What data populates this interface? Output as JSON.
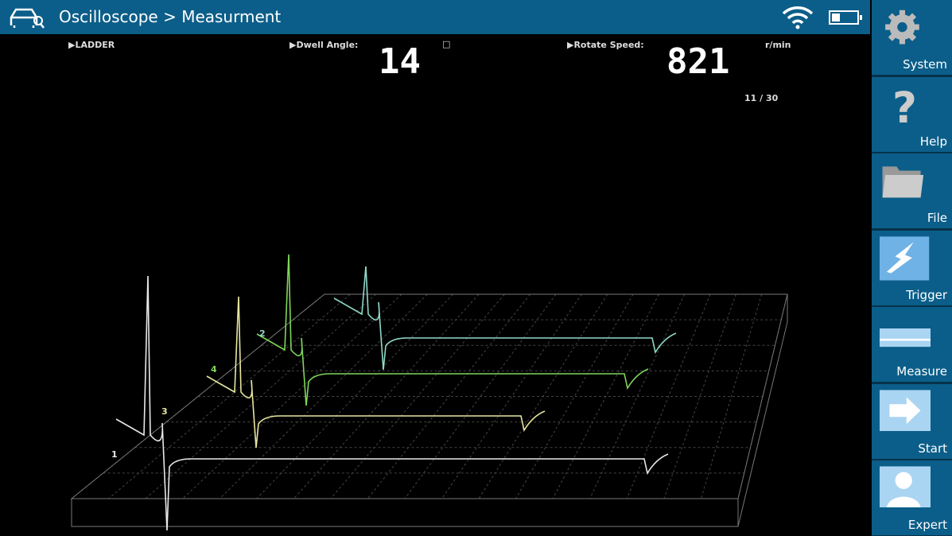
{
  "header": {
    "title": "Oscilloscope > Measurment",
    "car_icon": "car-diagnostic-icon",
    "wifi_icon": "wifi-icon",
    "battery_icon": "battery-icon"
  },
  "readouts": {
    "mode": "▶LADDER",
    "dwell_label": "▶Dwell Angle:",
    "dwell_value": "14",
    "dwell_unit": "□",
    "speed_label": "▶Rotate Speed:",
    "speed_value": "821",
    "speed_unit": "r/min",
    "page": "11 / 30"
  },
  "traces": [
    {
      "label": "1",
      "color": "#e8e8e8"
    },
    {
      "label": "3",
      "color": "#e6e6a0"
    },
    {
      "label": "4",
      "color": "#7fd65a"
    },
    {
      "label": "2",
      "color": "#8fd8c8"
    }
  ],
  "sidebar": [
    {
      "label": "System",
      "icon": "gear-icon"
    },
    {
      "label": "Help",
      "icon": "question-icon"
    },
    {
      "label": "File",
      "icon": "folder-icon"
    },
    {
      "label": "Trigger",
      "icon": "trigger-icon"
    },
    {
      "label": "Measure",
      "icon": "measure-icon"
    },
    {
      "label": "Start",
      "icon": "start-arrow-icon"
    },
    {
      "label": "Expert",
      "icon": "expert-icon"
    }
  ]
}
